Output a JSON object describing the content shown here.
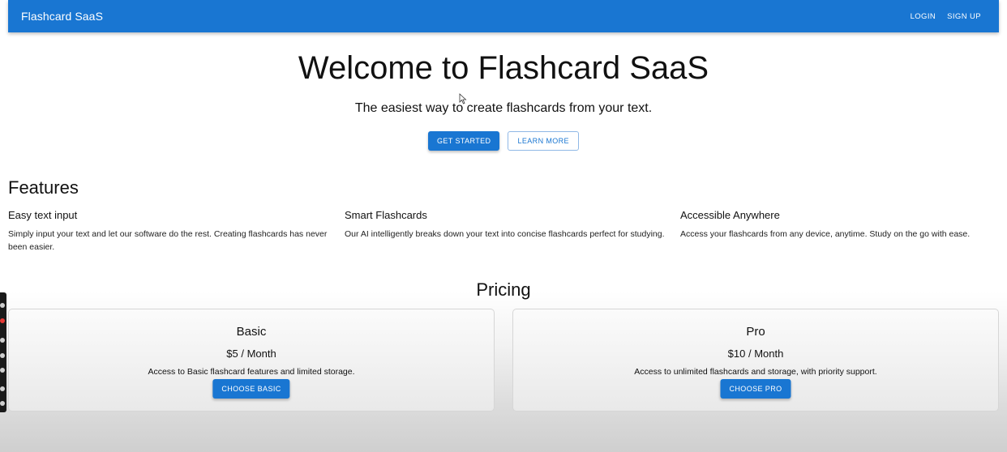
{
  "appbar": {
    "brand": "Flashcard SaaS",
    "login_label": "LOGIN",
    "signup_label": "SIGN UP",
    "color": "#1976d2"
  },
  "hero": {
    "title": "Welcome to Flashcard SaaS",
    "subtitle": "The easiest way to create flashcards from your text.",
    "get_started_label": "GET STARTED",
    "learn_more_label": "LEARN MORE"
  },
  "features": {
    "heading": "Features",
    "items": [
      {
        "title": "Easy text input",
        "description": "Simply input your text and let our software do the rest. Creating flashcards has never been easier."
      },
      {
        "title": "Smart Flashcards",
        "description": "Our AI intelligently breaks down your text into concise flashcards perfect for studying."
      },
      {
        "title": "Accessible Anywhere",
        "description": "Access your flashcards from any device, anytime. Study on the go with ease."
      }
    ]
  },
  "pricing": {
    "heading": "Pricing",
    "plans": [
      {
        "name": "Basic",
        "price": "$5 / Month",
        "description": "Access to Basic flashcard features and limited storage.",
        "button_label": "CHOOSE BASIC"
      },
      {
        "name": "Pro",
        "price": "$10 / Month",
        "description": "Access to unlimited flashcards and storage, with priority support.",
        "button_label": "CHOOSE PRO"
      }
    ]
  },
  "overlay": {
    "toolbar_icons": [
      "camera-icon",
      "record-icon",
      "pen-icon",
      "audio-icon",
      "webcam-icon",
      "folder-icon",
      "settings-icon"
    ],
    "cursor_icon": "mouse-pointer-icon"
  }
}
